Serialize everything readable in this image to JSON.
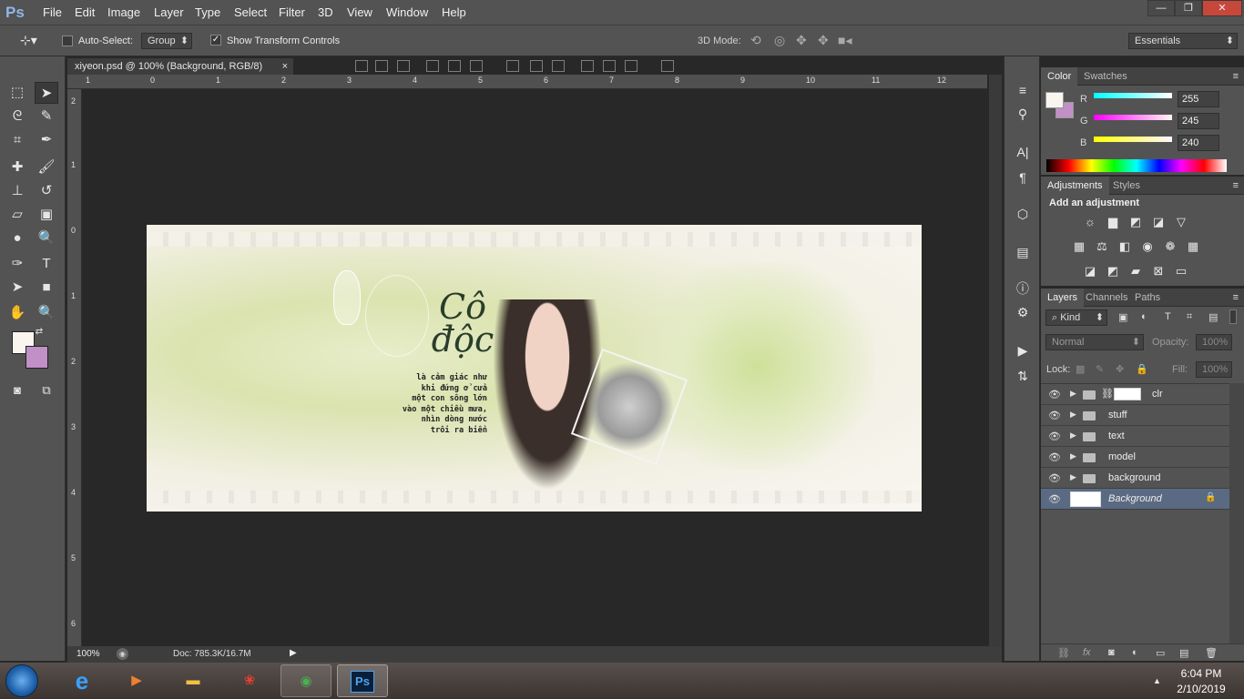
{
  "app": {
    "logo": "Ps"
  },
  "menubar": {
    "items": [
      "File",
      "Edit",
      "Image",
      "Layer",
      "Type",
      "Select",
      "Filter",
      "3D",
      "View",
      "Window",
      "Help"
    ]
  },
  "window_controls": {
    "minimize": "—",
    "restore": "❐",
    "close": "✕"
  },
  "options": {
    "tool_icon": "move-tool-icon",
    "auto_select_label": "Auto-Select:",
    "auto_select_value": "Group",
    "show_transform_label": "Show Transform Controls",
    "mode_3d_label": "3D Mode:",
    "workspace": "Essentials"
  },
  "document": {
    "tab_title": "xiyeon.psd @ 100% (Background, RGB/8)",
    "close": "×",
    "zoom": "100%",
    "doc_size": "Doc: 785.3K/16.7M"
  },
  "rulers": {
    "top": [
      "1",
      "0",
      "1",
      "2",
      "3",
      "4",
      "5",
      "6",
      "7",
      "8",
      "9",
      "10",
      "11",
      "12"
    ],
    "left": [
      "2",
      "1",
      "0",
      "1",
      "2",
      "3",
      "4",
      "5",
      "6"
    ]
  },
  "artwork": {
    "title": "Cô độc",
    "poem": [
      "là cảm giác như",
      "khi đứng ở cửa",
      "một con sông lớn",
      "vào một chiều mưa,",
      "nhìn dòng nước",
      "trôi ra biển"
    ]
  },
  "color_panel": {
    "tabs": [
      "Color",
      "Swatches"
    ],
    "channels": [
      {
        "label": "R",
        "value": "255"
      },
      {
        "label": "G",
        "value": "245"
      },
      {
        "label": "B",
        "value": "240"
      }
    ],
    "foreground": "#fbf5f0",
    "background": "#c090c6"
  },
  "adjustments_panel": {
    "tabs": [
      "Adjustments",
      "Styles"
    ],
    "heading": "Add an adjustment"
  },
  "layers_panel": {
    "tabs": [
      "Layers",
      "Channels",
      "Paths"
    ],
    "kind_label": "Kind",
    "blend_mode": "Normal",
    "opacity_label": "Opacity:",
    "opacity_value": "100%",
    "lock_label": "Lock:",
    "fill_label": "Fill:",
    "fill_value": "100%",
    "layers": [
      {
        "name": "clr",
        "type": "group-mask"
      },
      {
        "name": "stuff",
        "type": "group"
      },
      {
        "name": "text",
        "type": "group"
      },
      {
        "name": "model",
        "type": "group"
      },
      {
        "name": "background",
        "type": "group"
      },
      {
        "name": "Background",
        "type": "locked"
      }
    ]
  },
  "taskbar": {
    "time": "6:04 PM",
    "date": "2/10/2019",
    "ps_label": "Ps"
  },
  "colors": {
    "ui_bg": "#535353",
    "canvas_bg": "#282828",
    "accent_layer": "#5a6a82"
  }
}
